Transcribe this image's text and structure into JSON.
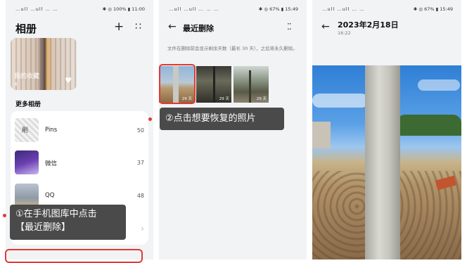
{
  "panel1": {
    "status_left": "…ull …ull … …",
    "status_right": "✱ ◎ 100% ▮ 11:00",
    "title": "相册",
    "plus_icon": "+",
    "more_icon": "∷",
    "favorites_label": "我的收藏",
    "favorites_count": "4",
    "section_title": "更多相册",
    "albums": [
      {
        "name": "Pins",
        "count": "50",
        "thumb_text": "刷"
      },
      {
        "name": "微信",
        "count": "37"
      },
      {
        "name": "QQ",
        "count": "48"
      }
    ]
  },
  "panel2": {
    "status_left": "…ull …ull … … …",
    "status_right": "✱ ◎ 67% ▮ 15:49",
    "title": "最近删除",
    "note": "文件在删除前会显示剩余天数（最长 30 天），之后将永久删除。",
    "photos": [
      {
        "days": "29 天"
      },
      {
        "days": "29 天"
      },
      {
        "days": "29 天"
      }
    ]
  },
  "panel3": {
    "status_left": "…ull …ull … …",
    "status_right": "✱ ◎ 67% ▮ 15:49",
    "date": "2023年2月18日",
    "time": "16:22"
  },
  "callouts": {
    "step1_line1": "①在手机图库中点击",
    "step1_line2": "【最近删除】",
    "step2": "②点击想要恢复的照片"
  },
  "colors": {
    "highlight": "#e03a34",
    "callout_bg": "#4a4a4a",
    "panel_bg": "#f1f3f5"
  }
}
